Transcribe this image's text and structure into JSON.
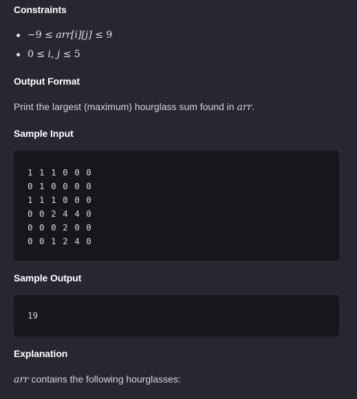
{
  "constraints": {
    "heading": "Constraints",
    "items": [
      {
        "prefix": "−9 ≤ ",
        "var": "arr[i][j]",
        "suffix": " ≤ 9"
      },
      {
        "prefix": "0 ≤ ",
        "var": "i, j",
        "suffix": " ≤ 5"
      }
    ]
  },
  "output_format": {
    "heading": "Output Format",
    "text_before": "Print the largest (maximum) hourglass sum found in ",
    "math": "arr",
    "text_after": "."
  },
  "sample_input": {
    "heading": "Sample Input",
    "lines": [
      "1 1 1 0 0 0",
      "0 1 0 0 0 0",
      "1 1 1 0 0 0",
      "0 0 2 4 4 0",
      "0 0 0 2 0 0",
      "0 0 1 2 4 0"
    ]
  },
  "sample_output": {
    "heading": "Sample Output",
    "value": "19"
  },
  "explanation": {
    "heading": "Explanation",
    "math": "arr",
    "text": " contains the following hourglasses:"
  }
}
